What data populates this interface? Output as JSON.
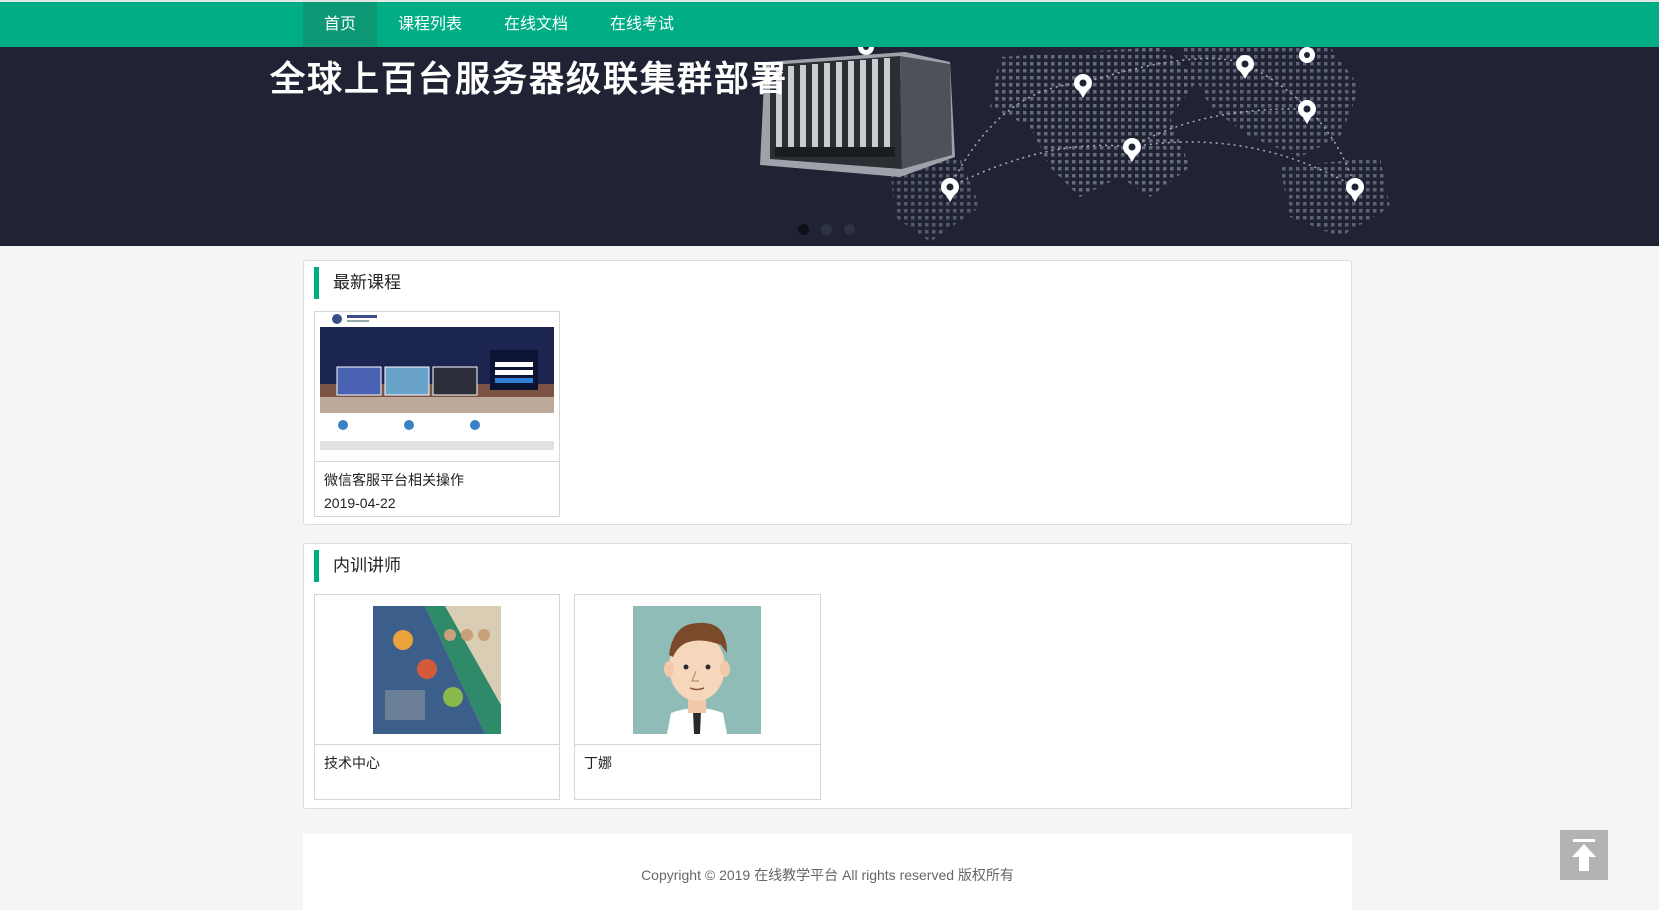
{
  "nav": {
    "items": [
      {
        "label": "首页",
        "active": true
      },
      {
        "label": "课程列表",
        "active": false
      },
      {
        "label": "在线文档",
        "active": false
      },
      {
        "label": "在线考试",
        "active": false
      }
    ]
  },
  "banner": {
    "headline": "全球上百台服务器级联集群部署",
    "slide_count": 3,
    "active_slide": 1
  },
  "latest_courses": {
    "title": "最新课程",
    "courses": [
      {
        "name": "微信客服平台相关操作",
        "date": "2019-04-22"
      }
    ]
  },
  "instructors": {
    "title": "内训讲师",
    "items": [
      {
        "name": "技术中心"
      },
      {
        "name": "丁娜"
      }
    ]
  },
  "footer": {
    "copyright": "Copyright © 2019 在线教学平台 All rights reserved 版权所有"
  },
  "colors": {
    "brand": "#00ad85",
    "nav_active": "#0b9874",
    "banner_bg": "#1f2333"
  },
  "icons": {
    "back_to_top": "arrow-up-icon"
  }
}
